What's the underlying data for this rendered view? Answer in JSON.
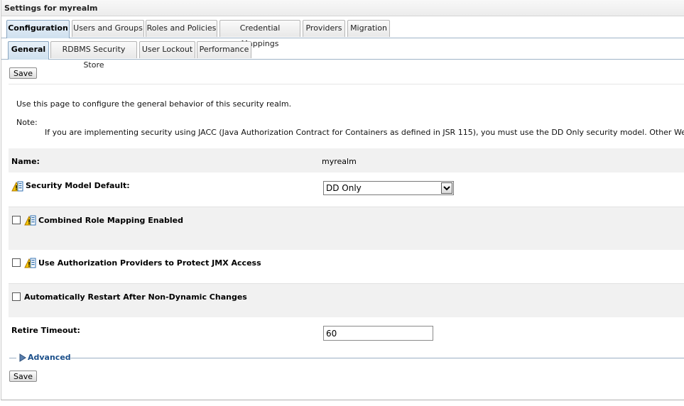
{
  "title": "Settings for myrealm",
  "tabs_primary": [
    "Configuration",
    "Users and Groups",
    "Roles and Policies",
    "Credential Mappings",
    "Providers",
    "Migration"
  ],
  "tabs_secondary": [
    "General",
    "RDBMS Security Store",
    "User Lockout",
    "Performance"
  ],
  "save_label": "Save",
  "intro_text": "Use this page to configure the general behavior of this security realm.",
  "note_label": "Note:",
  "note_text": "If you are implementing security using JACC (Java Authorization Contract for Containers as defined in JSR 115), you must use the DD Only security model. Other WebLogic Server model",
  "fields": {
    "name_label": "Name:",
    "name_value": "myrealm",
    "security_model_label": "Security Model Default:",
    "security_model_value": "DD Only",
    "combined_role_label": "Combined Role Mapping Enabled",
    "use_auth_label": "Use Authorization Providers to Protect JMX Access",
    "auto_restart_label": "Automatically Restart After Non-Dynamic Changes",
    "retire_timeout_label": "Retire Timeout:",
    "retire_timeout_value": "60"
  },
  "advanced_label": "Advanced",
  "icons": {
    "restart_warning": "warning-restart-icon",
    "advanced_toggle": "triangle-right-icon"
  },
  "colors": {
    "active_tab": "#cfe0ef",
    "link": "#1b4f8a",
    "row_shade": "#f1f1f1"
  }
}
